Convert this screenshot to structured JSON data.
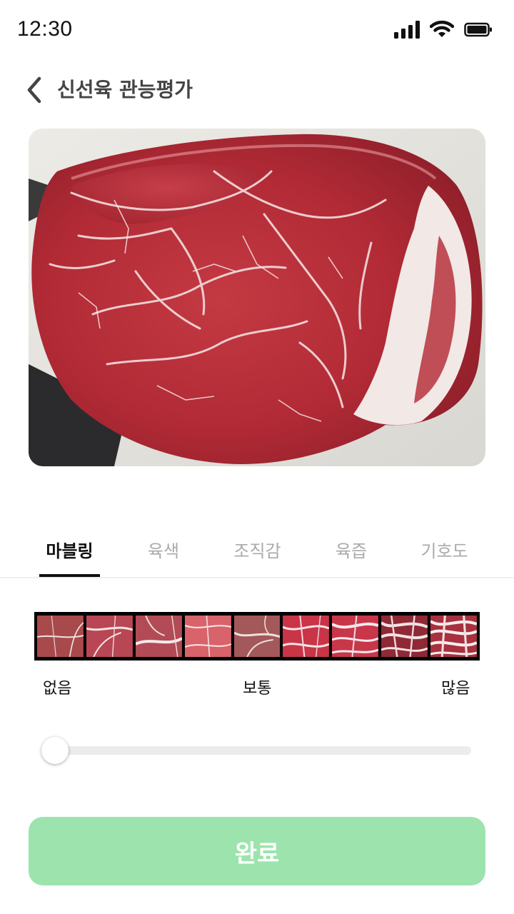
{
  "status_bar": {
    "time": "12:30",
    "icons": [
      "signal-icon",
      "wifi-icon",
      "battery-icon"
    ]
  },
  "header": {
    "back_icon": "chevron-left-icon",
    "title": "신선육 관능평가"
  },
  "photo": {
    "subject": "meat-photo"
  },
  "tabs": [
    {
      "label": "마블링",
      "active": true
    },
    {
      "label": "육색",
      "active": false
    },
    {
      "label": "조직감",
      "active": false
    },
    {
      "label": "육즙",
      "active": false
    },
    {
      "label": "기호도",
      "active": false
    }
  ],
  "marbling_scale": {
    "sample_count": 9,
    "labels": {
      "low": "없음",
      "mid": "보통",
      "high": "많음"
    }
  },
  "slider": {
    "value": 0,
    "min": 0,
    "max": 1
  },
  "complete_button": {
    "label": "완료"
  },
  "colors": {
    "accent": "#9de3ad",
    "tab_active": "#111111",
    "tab_inactive": "#aaaaaa",
    "slider_track": "#ececec"
  }
}
